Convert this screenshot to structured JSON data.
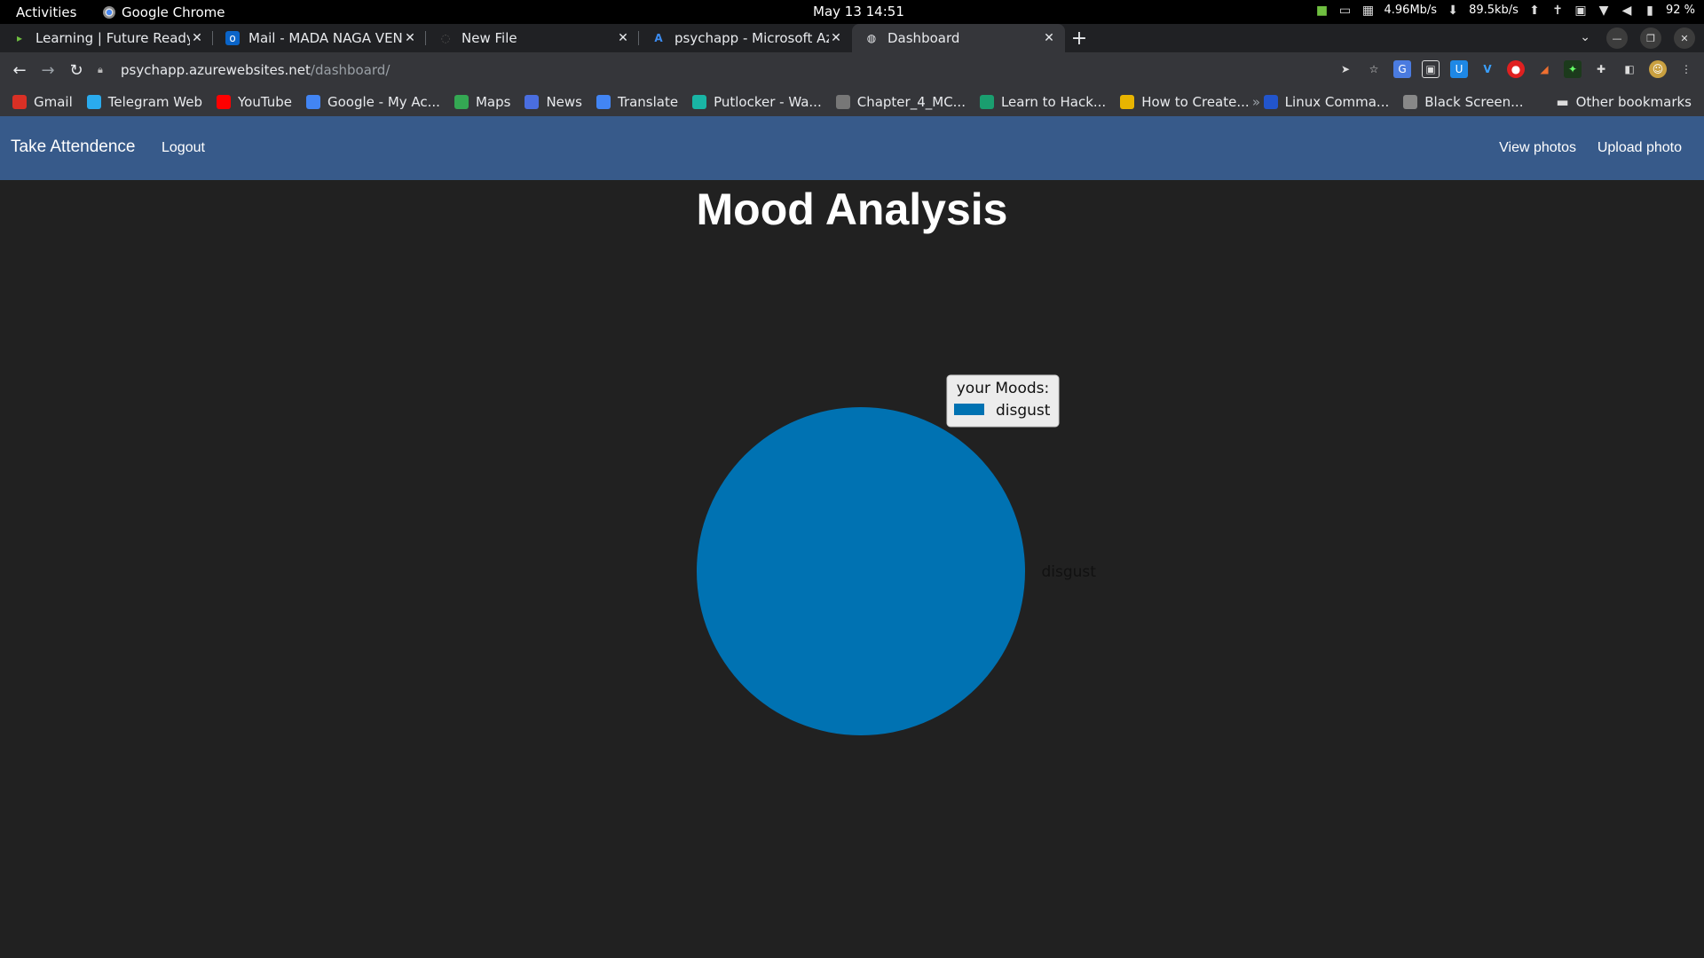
{
  "system": {
    "activities": "Activities",
    "app": "Google Chrome",
    "clock": "May 13  14:51",
    "net_down": "4.96Mb/s",
    "net_up": "89.5kb/s",
    "battery": "92 %"
  },
  "tabs": [
    {
      "title": "Learning | Future Ready T",
      "icon": "learning-favicon"
    },
    {
      "title": "Mail - MADA NAGA VENKA",
      "icon": "outlook-favicon"
    },
    {
      "title": "New File",
      "icon": "loading-favicon"
    },
    {
      "title": "psychapp - Microsoft Azu",
      "icon": "azure-favicon"
    },
    {
      "title": "Dashboard",
      "icon": "globe-favicon",
      "active": true
    }
  ],
  "address": {
    "host": "psychapp.azurewebsites.net",
    "path": "/dashboard/"
  },
  "bookmarks": [
    {
      "label": "Gmail",
      "icon": "gmail-icon",
      "color": "#d93025"
    },
    {
      "label": "Telegram Web",
      "icon": "telegram-icon",
      "color": "#2aabee"
    },
    {
      "label": "YouTube",
      "icon": "youtube-icon",
      "color": "#ff0000"
    },
    {
      "label": "Google - My Ac...",
      "icon": "google-icon",
      "color": "#4285f4"
    },
    {
      "label": "Maps",
      "icon": "maps-icon",
      "color": "#34a853"
    },
    {
      "label": "News",
      "icon": "news-icon",
      "color": "#4a6ee0"
    },
    {
      "label": "Translate",
      "icon": "translate-icon",
      "color": "#4285f4"
    },
    {
      "label": "Putlocker - Wa...",
      "icon": "putlocker-icon",
      "color": "#19b5a5"
    },
    {
      "label": "Chapter_4_MC...",
      "icon": "globe-icon",
      "color": "#777777"
    },
    {
      "label": "Learn to Hack...",
      "icon": "hack-icon",
      "color": "#1a9e6f"
    },
    {
      "label": "How to Create...",
      "icon": "k-icon",
      "color": "#e8b400"
    },
    {
      "label": "Linux Comma...",
      "icon": "linux-icon",
      "color": "#2255cc"
    },
    {
      "label": "Black Screen...",
      "icon": "blackscreen-icon",
      "color": "#888888"
    }
  ],
  "other_bookmarks": "Other bookmarks",
  "navbar": {
    "brand": "Take Attendence",
    "logout": "Logout",
    "view_photos": "View photos",
    "upload_photo": "Upload photo"
  },
  "page": {
    "title": "Mood Analysis"
  },
  "chart_data": {
    "type": "pie",
    "categories": [
      "disgust"
    ],
    "values": [
      1
    ],
    "colors": [
      "#0072b2"
    ],
    "legend_title": "your Moods:",
    "legend_placement": "top-right"
  }
}
